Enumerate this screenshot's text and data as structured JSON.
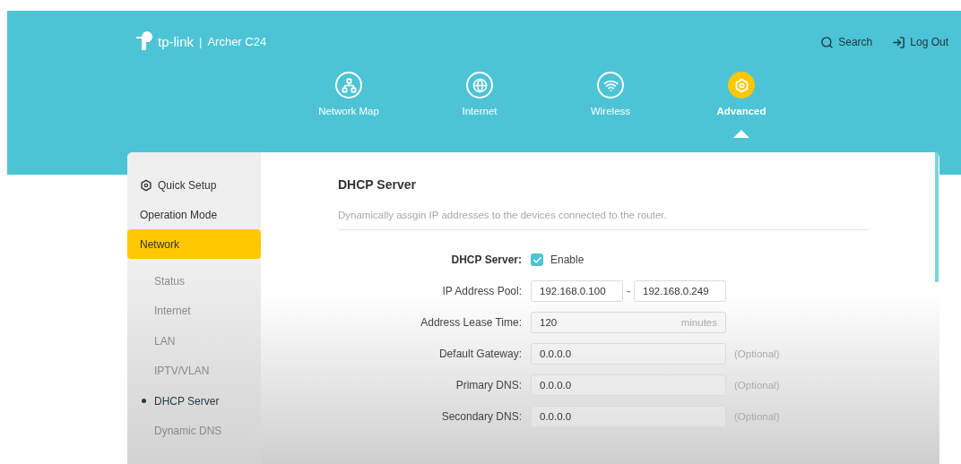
{
  "header": {
    "brand": "tp-link",
    "separator": "|",
    "model": "Archer C24",
    "search": "Search",
    "logout": "Log Out"
  },
  "nav": [
    {
      "label": "Network Map",
      "kind": "network",
      "selected": false
    },
    {
      "label": "Internet",
      "kind": "globe",
      "selected": false
    },
    {
      "label": "Wireless",
      "kind": "wifi",
      "selected": false
    },
    {
      "label": "Advanced",
      "kind": "gear",
      "selected": true
    }
  ],
  "sidebar": {
    "items": [
      {
        "label": "Quick Setup",
        "kind": "setup",
        "selected": false
      },
      {
        "label": "Operation Mode",
        "kind": "main",
        "selected": false
      },
      {
        "label": "Network",
        "kind": "main",
        "selected": true
      },
      {
        "label": "Status",
        "kind": "sub",
        "selected": false
      },
      {
        "label": "Internet",
        "kind": "sub",
        "selected": false
      },
      {
        "label": "LAN",
        "kind": "sub",
        "selected": false
      },
      {
        "label": "IPTV/VLAN",
        "kind": "sub",
        "selected": false
      },
      {
        "label": "DHCP Server",
        "kind": "sub",
        "selected": true
      },
      {
        "label": "Dynamic DNS",
        "kind": "sub",
        "selected": false
      }
    ]
  },
  "form": {
    "title": "DHCP Server",
    "description": "Dynamically assgin IP addresses to the devices connected to the router.",
    "rows": [
      {
        "kind": "checkbox",
        "label": "DHCP Server:",
        "checked": true,
        "text": "Enable"
      },
      {
        "kind": "range",
        "label": "IP Address Pool:",
        "from": "192.168.0.100",
        "separator": "-",
        "to": "192.168.0.249"
      },
      {
        "kind": "unit",
        "label": "Address Lease Time:",
        "value": "120",
        "unit": "minutes"
      },
      {
        "kind": "optional",
        "label": "Default Gateway:",
        "value": "0.0.0.0",
        "note": "(Optional)"
      },
      {
        "kind": "optional",
        "label": "Primary DNS:",
        "value": "0.0.0.0",
        "note": "(Optional)"
      },
      {
        "kind": "optional",
        "label": "Secondary DNS:",
        "value": "0.0.0.0",
        "note": "(Optional)"
      }
    ]
  }
}
